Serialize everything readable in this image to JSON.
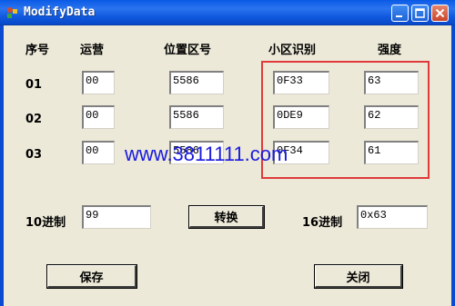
{
  "window": {
    "title": "ModifyData"
  },
  "headers": {
    "index": "序号",
    "operator": "运营",
    "lac": "位置区号",
    "cell_id": "小区识别",
    "strength": "强度"
  },
  "rows": [
    {
      "index": "01",
      "operator": "00",
      "lac": "5586",
      "cell_id": "0F33",
      "strength": "63"
    },
    {
      "index": "02",
      "operator": "00",
      "lac": "5586",
      "cell_id": "0DE9",
      "strength": "62"
    },
    {
      "index": "03",
      "operator": "00",
      "lac": "5586",
      "cell_id": "0F34",
      "strength": "61"
    }
  ],
  "converter": {
    "decimal_label": "10进制",
    "decimal_value": "99",
    "convert_button": "转换",
    "hex_label": "16进制",
    "hex_value": "0x63"
  },
  "footer": {
    "save_button": "保存",
    "close_button": "关闭"
  },
  "watermark": "www.3811111.com",
  "colors": {
    "highlight": "#e03a3a",
    "watermark": "#1a1ae0",
    "titlebar": "#0a5ae6"
  }
}
